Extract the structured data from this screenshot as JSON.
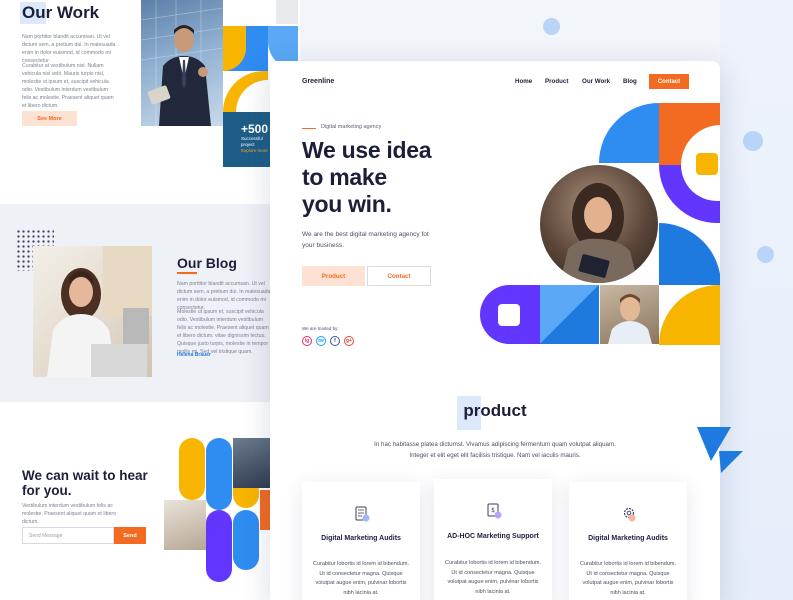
{
  "our_work": {
    "title": "Our Work",
    "para1": "Nam porttitor blandit accumsan. Ut vel dictum sem, a pretium dui. In malesuada enim in dolor euismod, id commodo mi consectetur.",
    "para2": "Curabitur at vestibulum nisi. Nullam vehicula nisi velit. Mauris turpis nisl, molestie ut ipsum et, suscipit vehicula odio. Vestibulum interdum vestibulum felis ac molestie. Praesent aliquet quam et libero dictum.",
    "see_more": "See More",
    "stat_number": "+500",
    "stat_label": "Successful project",
    "stat_label2": "Explore more"
  },
  "blog": {
    "title": "Our Blog",
    "para1": "Nam porttitor blandit accumsan. Ut vel dictum sem, a pretium dui. In malesuada enim in dolor euismod, id commodo mi consectetur.",
    "para2": "Molestie ut ipsum et, suscipit vehicula odio. Vestibulum interdum vestibulum felis ac molestie. Praesent aliquet quam et libero dictum. vitae dignissim lectus. Quisque justo turpis, molestie in tempor mollis mi. Sed vel tristique quam.",
    "author": "Helena Brauer"
  },
  "contact_section": {
    "title": "We can wait to hear for you.",
    "para": "Vestibulum interdum vestibulum felis ac molestie. Praesent aliquet quam et libero dictum.",
    "input_placeholder": "Send Message",
    "send": "Send"
  },
  "nav": {
    "logo": "Greenline",
    "items": [
      "Home",
      "Product",
      "Our Work",
      "Blog"
    ],
    "contact": "Contact"
  },
  "hero": {
    "eyebrow": "Digital marketing agency",
    "title": "We use idea to make you win.",
    "subtitle": "We are the best digital marketing agency fot your business.",
    "btn_product": "Product",
    "btn_contact": "Contact",
    "trusted": "We are trusted by:",
    "social": [
      "ig",
      "tw",
      "f",
      "g+"
    ]
  },
  "product": {
    "title": "product",
    "description": "In hac habitasse platea dictumst. Vivamus adipiscing fermentum quam volutpat aliquam. Integer et elit eget elit facilisis tristique. Nam vel iaculis mauris.",
    "cards": [
      {
        "title": "Digital Marketing Audits",
        "text": "Curabitur lobortis id lorem id bibendum. Ut id consectetur magna. Quisque volutpat augue enim, pulvinar lobortis nibh lacinia at."
      },
      {
        "title": "AD-HOC Marketing Support",
        "text": "Curabitur lobortis id lorem id bibendum. Ut id consectetur magna. Quisque volutpat augue enim, pulvinar lobortis nibh lacinia at."
      },
      {
        "title": "Digital Marketing Audits",
        "text": "Curabitur lobortis id lorem id bibendum. Ut id consectetur magna. Quisque volutpat augue enim, pulvinar lobortis nibh lacinia at."
      }
    ]
  },
  "colors": {
    "accent_orange": "#f26b21",
    "blue": "#2f8cf0",
    "purple": "#6236ff",
    "yellow": "#f7b500",
    "navy": "#1c1f3a"
  }
}
